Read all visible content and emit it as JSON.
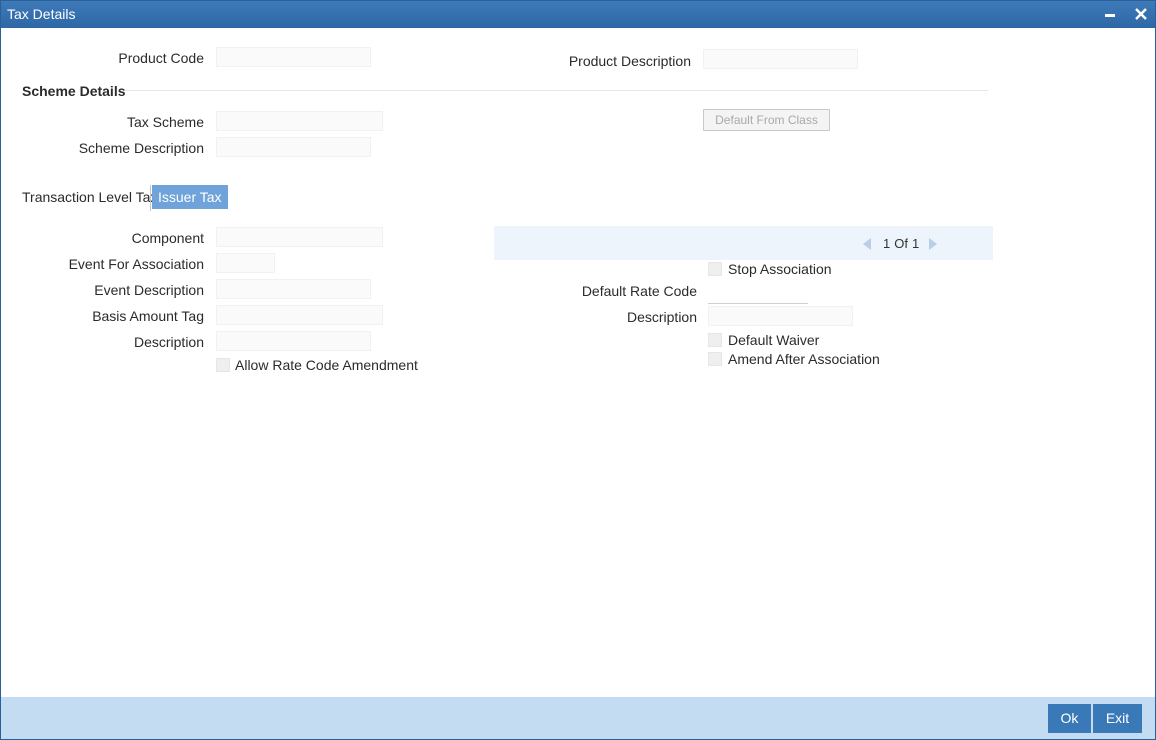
{
  "window": {
    "title": "Tax Details"
  },
  "header": {
    "product_code_label": "Product Code",
    "product_code_value": "",
    "product_description_label": "Product Description",
    "product_description_value": ""
  },
  "scheme": {
    "section_title": "Scheme Details",
    "tax_scheme_label": "Tax Scheme",
    "tax_scheme_value": "",
    "scheme_description_label": "Scheme Description",
    "scheme_description_value": "",
    "default_from_class_button": "Default From Class"
  },
  "tabs": [
    {
      "label": "Transaction Level Tax",
      "active": false
    },
    {
      "label": "Issuer Tax",
      "active": true
    }
  ],
  "detail": {
    "component_label": "Component",
    "component_value": "",
    "event_for_association_label": "Event For Association",
    "event_for_association_value": "",
    "event_description_label": "Event Description",
    "event_description_value": "",
    "basis_amount_tag_label": "Basis Amount Tag",
    "basis_amount_tag_value": "",
    "description_label": "Description",
    "description_value": "",
    "allow_rate_code_amendment_label": "Allow Rate Code Amendment",
    "allow_rate_code_amendment_checked": false,
    "pager": {
      "current": "1",
      "of_label": "Of",
      "total": "1"
    },
    "stop_association_label": "Stop Association",
    "stop_association_checked": false,
    "default_rate_code_label": "Default Rate Code",
    "default_rate_code_value": "",
    "rate_description_label": "Description",
    "rate_description_value": "",
    "default_waiver_label": "Default Waiver",
    "default_waiver_checked": false,
    "amend_after_association_label": "Amend After Association",
    "amend_after_association_checked": false
  },
  "footer": {
    "ok_label": "Ok",
    "exit_label": "Exit"
  },
  "colors": {
    "titlebar": "#2d67a6",
    "active_tab": "#6fa3d9",
    "footer_band": "#c3dcf2",
    "footer_button": "#3a79b7"
  },
  "icons": {
    "minimize": "minimize-icon",
    "close": "close-icon",
    "prev": "chevron-left-icon",
    "next": "chevron-right-icon"
  }
}
